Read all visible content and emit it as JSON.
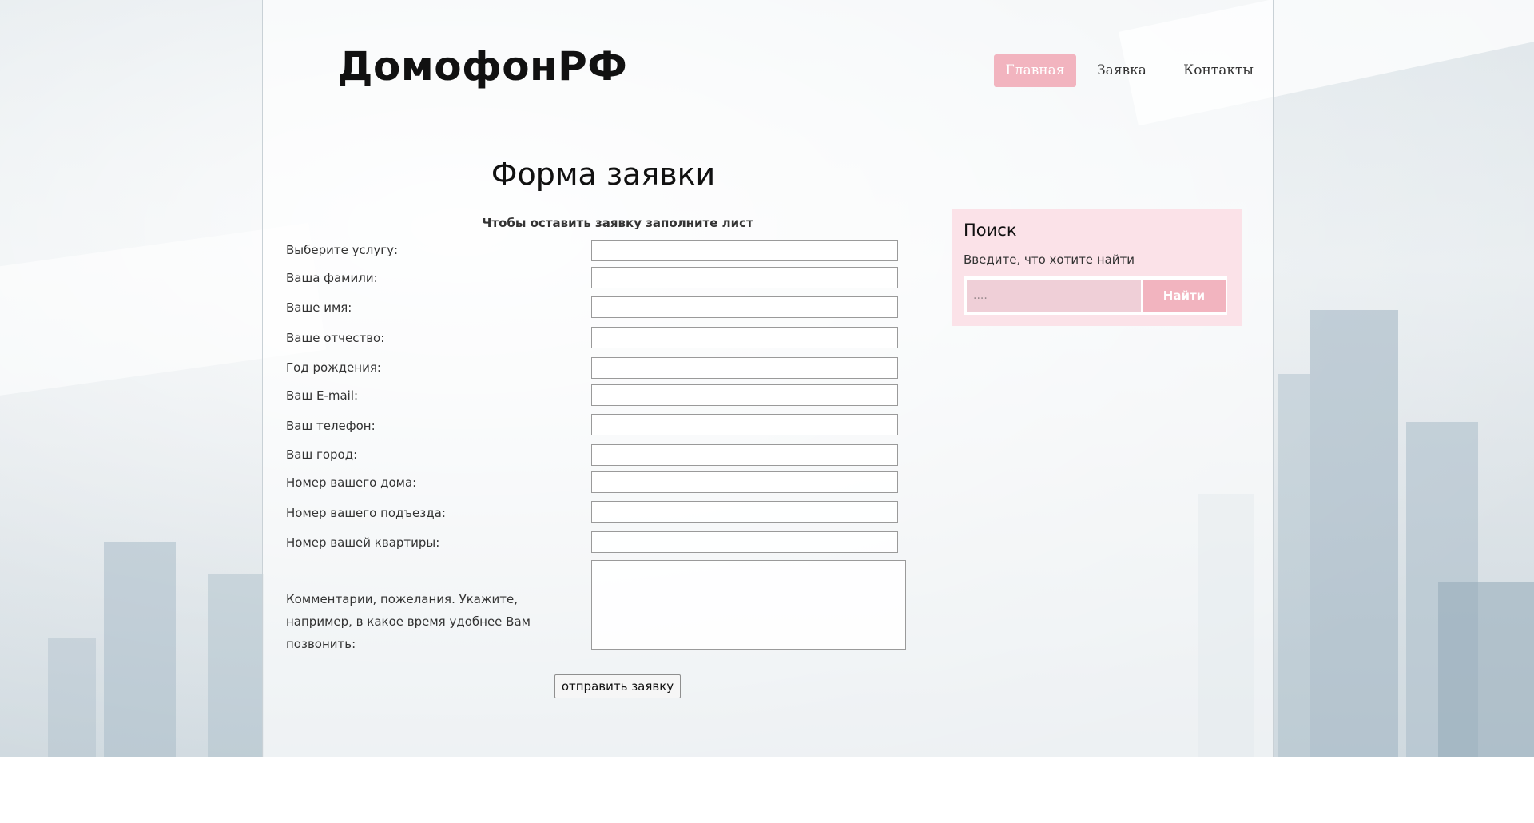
{
  "header": {
    "logo": "ДомофонРФ",
    "nav": [
      {
        "label": "Главная",
        "active": true
      },
      {
        "label": "Заявка",
        "active": false
      },
      {
        "label": "Контакты",
        "active": false
      }
    ]
  },
  "form": {
    "title": "Форма заявки",
    "subtitle": "Чтобы оставить заявку заполните лист",
    "fields": [
      {
        "label": "Выберите услугу:",
        "value": ""
      },
      {
        "label": "Ваша фамили:",
        "value": ""
      },
      {
        "label": "Ваше имя:",
        "value": ""
      },
      {
        "label": "Ваше отчество:",
        "value": ""
      },
      {
        "label": "Год рождения:",
        "value": ""
      },
      {
        "label": "Ваш E-mail:",
        "value": ""
      },
      {
        "label": "Ваш телефон:",
        "value": ""
      },
      {
        "label": "Ваш город:",
        "value": ""
      },
      {
        "label": "Номер вашего дома:",
        "value": ""
      },
      {
        "label": "Номер вашего подъезда:",
        "value": ""
      },
      {
        "label": "Номер вашей квартиры:",
        "value": ""
      }
    ],
    "comment_label": "Комментарии, пожелания. Укажите, например, в какое время удобнее Вам позвонить:",
    "comment_value": "",
    "submit_label": "отправить заявку"
  },
  "search": {
    "title": "Поиск",
    "hint": "Введите, что хотите найти",
    "placeholder": "....",
    "button_label": "Найти"
  },
  "colors": {
    "accent": "#f2b4bf",
    "search_bg": "#fbe2e8",
    "search_input_bg": "#efcfd7"
  }
}
